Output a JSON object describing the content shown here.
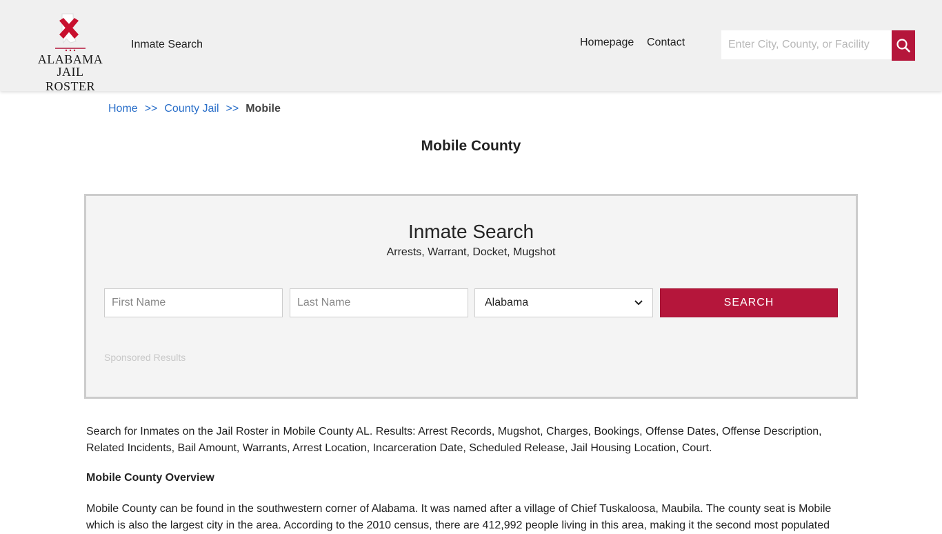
{
  "logo": {
    "line1": "ALABAMA",
    "line2": "JAIL ROSTER"
  },
  "nav": {
    "inmate_search": "Inmate Search",
    "homepage": "Homepage",
    "contact": "Contact"
  },
  "header_search": {
    "placeholder": "Enter City, County, or Facility",
    "icon": "search-icon"
  },
  "breadcrumb": {
    "home": "Home",
    "sep": ">>",
    "county_jail": "County Jail",
    "current": "Mobile"
  },
  "page_title": "Mobile County",
  "search_panel": {
    "title": "Inmate Search",
    "subtitle": "Arrests, Warrant, Docket, Mugshot",
    "first_name_placeholder": "First Name",
    "last_name_placeholder": "Last Name",
    "state_selected": "Alabama",
    "submit_label": "SEARCH",
    "sponsored": "Sponsored Results"
  },
  "content": {
    "intro": "Search for Inmates on the Jail Roster in Mobile County AL. Results: Arrest Records, Mugshot, Charges, Bookings, Offense Dates, Offense Description, Related Incidents, Bail Amount, Warrants, Arrest Location, Incarceration Date, Scheduled Release, Jail Housing Location, Court.",
    "overview_heading": "Mobile County Overview",
    "overview_text": "Mobile County can be found in the southwestern corner of Alabama. It was named after a village of Chief Tuskaloosa, Maubila. The county seat is Mobile which is also the largest city in the area. According to the 2010 census, there are 412,992 people living in this area, making it the second most populated"
  },
  "colors": {
    "accent": "#b5163b",
    "link": "#2a6fc9",
    "header_bg": "#f0f0f0",
    "panel_bg": "#f4f4f4"
  }
}
